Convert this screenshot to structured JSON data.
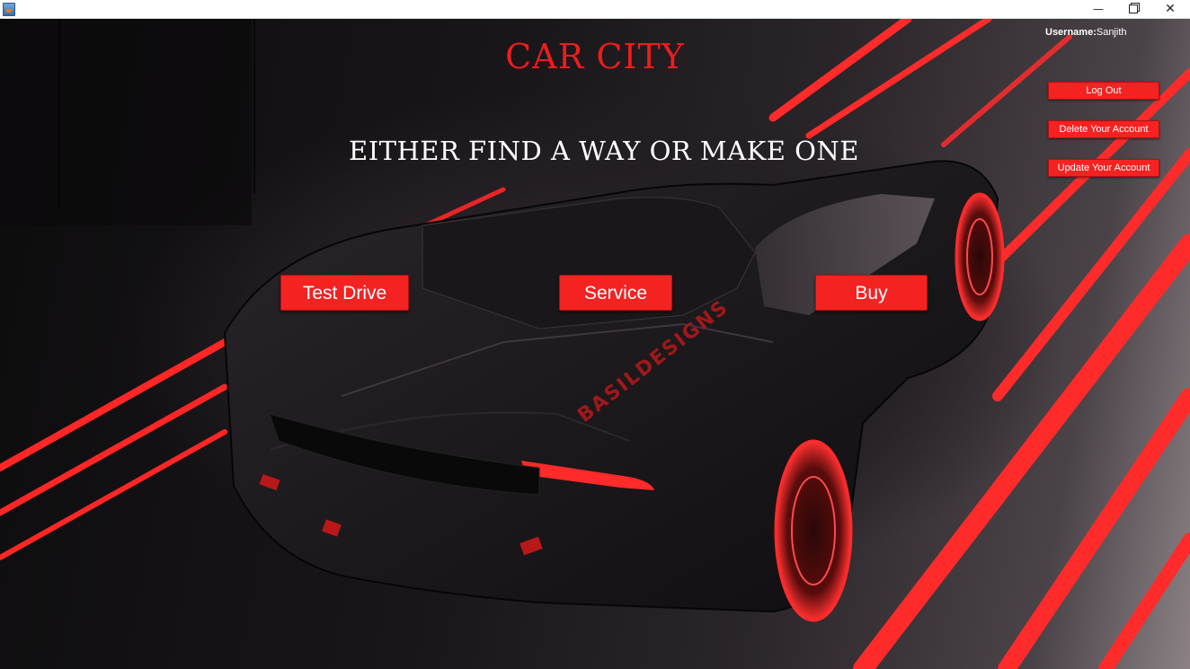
{
  "window": {
    "minimize_glyph": "—",
    "close_glyph": "✕"
  },
  "header": {
    "title": "CAR CITY",
    "tagline": "EITHER FIND A WAY OR MAKE ONE"
  },
  "user": {
    "label": "Username:",
    "value": "Sanjith"
  },
  "account_actions": {
    "logout": "Log Out",
    "delete": "Delete Your Account",
    "update": "Update Your Account"
  },
  "main_actions": {
    "test_drive": "Test Drive",
    "service": "Service",
    "buy": "Buy"
  },
  "car_decal": "BASILDESIGNS",
  "colors": {
    "accent_red": "#f52222",
    "title_red": "#ee1c1c",
    "background": "#1a171a"
  }
}
